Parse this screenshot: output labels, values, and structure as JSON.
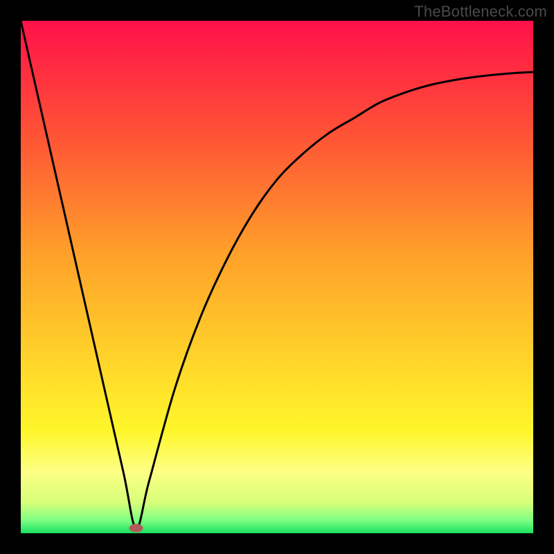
{
  "watermark": "TheBottleneck.com",
  "chart_data": {
    "type": "line",
    "title": "",
    "xlabel": "",
    "ylabel": "",
    "xlim": [
      0,
      100
    ],
    "ylim": [
      0,
      100
    ],
    "series": [
      {
        "name": "curve",
        "x": [
          0,
          5,
          10,
          15,
          20,
          22.5,
          25,
          30,
          35,
          40,
          45,
          50,
          55,
          60,
          65,
          70,
          75,
          80,
          85,
          90,
          95,
          100
        ],
        "y": [
          100,
          78,
          56,
          34,
          12,
          1,
          10,
          28,
          42,
          53,
          62,
          69,
          74,
          78,
          81,
          84,
          86,
          87.5,
          88.5,
          89.2,
          89.7,
          90
        ]
      }
    ],
    "marker": {
      "x": 22.5,
      "y": 1,
      "color": "#b25a5a",
      "name": "minimum-marker"
    },
    "background_gradient": {
      "stops": [
        {
          "offset": 0.0,
          "color": "#ff1149"
        },
        {
          "offset": 0.22,
          "color": "#ff5236"
        },
        {
          "offset": 0.45,
          "color": "#ff9f2a"
        },
        {
          "offset": 0.68,
          "color": "#ffd92a"
        },
        {
          "offset": 0.8,
          "color": "#fff62a"
        },
        {
          "offset": 0.88,
          "color": "#fdff84"
        },
        {
          "offset": 0.94,
          "color": "#d8ff7a"
        },
        {
          "offset": 0.975,
          "color": "#7dff82"
        },
        {
          "offset": 1.0,
          "color": "#18e060"
        }
      ]
    }
  }
}
